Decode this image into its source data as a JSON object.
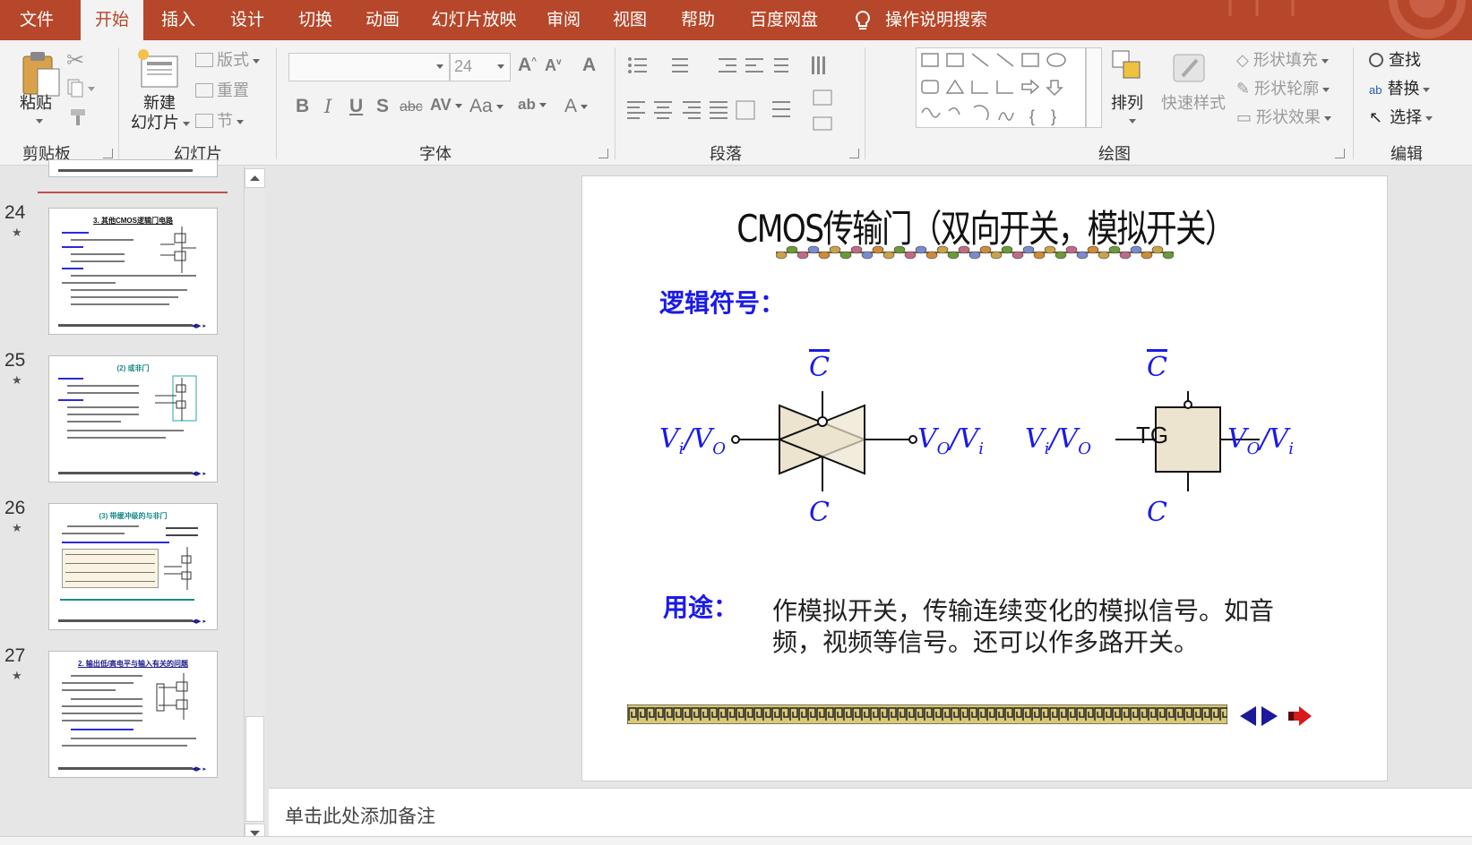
{
  "ribbon_tabs": [
    "文件",
    "开始",
    "插入",
    "设计",
    "切换",
    "动画",
    "幻灯片放映",
    "审阅",
    "视图",
    "帮助",
    "百度网盘"
  ],
  "active_tab": "开始",
  "tell_me": "操作说明搜索",
  "clipboard": {
    "paste": "粘贴",
    "group": "剪贴板"
  },
  "slides_group": {
    "new_slide_1": "新建",
    "new_slide_2": "幻灯片",
    "layout": "版式",
    "reset": "重置",
    "section": "节",
    "group": "幻灯片"
  },
  "font_group": {
    "font_size": "24",
    "case": "Aa",
    "group": "字体"
  },
  "paragraph_group": {
    "group": "段落"
  },
  "drawing_group": {
    "arrange": "排列",
    "quick_styles": "快速样式",
    "shape_fill": "形状填充",
    "shape_outline": "形状轮廓",
    "shape_effects": "形状效果",
    "group": "绘图"
  },
  "editing_group": {
    "find": "查找",
    "replace": "替换",
    "select": "选择",
    "group": "编辑"
  },
  "thumbnails": [
    {
      "num": "24",
      "title": "3. 其他CMOS逻辑门电路"
    },
    {
      "num": "25",
      "title": "(2) 或非门"
    },
    {
      "num": "26",
      "title": "(3) 带缓冲级的与非门"
    },
    {
      "num": "27",
      "title": "2. 输出低/高电平与输入有关的问题"
    }
  ],
  "slide": {
    "title": "CMOS传输门（双向开关，模拟开关）",
    "logic_symbol_label": "逻辑符号：",
    "usage_label": "用途：",
    "usage_text": "作模拟开关，传输连续变化的模拟信号。如音频，视频等信号。还可以作多路开关。",
    "tg_label": "TG",
    "control": "C"
  },
  "notes_placeholder": "单击此处添加备注",
  "colors": {
    "accent": "#b7472a",
    "slide_blue": "#1a1ae8",
    "symbol_fill": "#ece4cf"
  }
}
